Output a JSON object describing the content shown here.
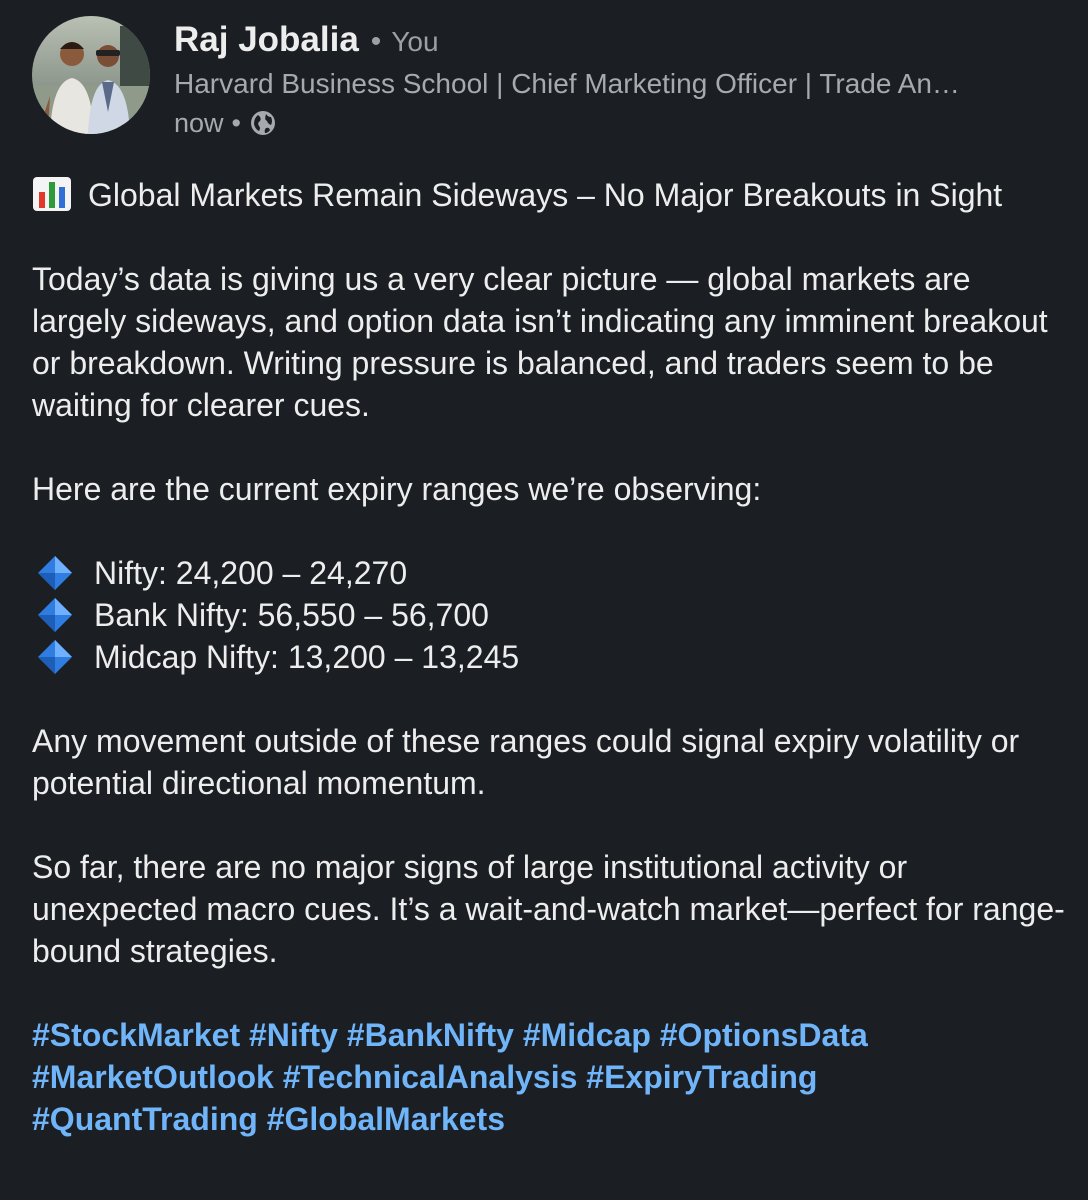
{
  "author": {
    "name": "Raj Jobalia",
    "relation": "You",
    "headline": "Harvard Business School | Chief Marketing Officer | Trade An…",
    "time": "now",
    "visibility_icon": "globe-icon"
  },
  "post": {
    "title_icon": "bar-chart-emoji",
    "title": "Global Markets Remain Sideways – No Major Breakouts in Sight",
    "intro": "Today’s data is giving us a very clear picture — global markets are largely sideways, and option data isn’t indicating any imminent breakout or breakdown. Writing pressure is balanced, and traders seem to be waiting for clearer cues.",
    "ranges_heading": "Here are the current expiry ranges we’re observing:",
    "ranges": [
      {
        "icon": "blue-diamond-emoji",
        "text": "Nifty: 24,200 – 24,270"
      },
      {
        "icon": "blue-diamond-emoji",
        "text": "Bank Nifty: 56,550 – 56,700"
      },
      {
        "icon": "blue-diamond-emoji",
        "text": "Midcap Nifty: 13,200 – 13,245"
      }
    ],
    "paragraph_movement": "Any movement outside of these ranges could signal expiry volatility or potential directional momentum.",
    "paragraph_outlook": "So far, there are no major signs of large institutional activity or unexpected macro cues. It’s a wait-and-watch market—perfect for range-bound strategies.",
    "hashtags": [
      "#StockMarket",
      "#Nifty",
      "#BankNifty",
      "#Midcap",
      "#OptionsData",
      "#MarketOutlook",
      "#TechnicalAnalysis",
      "#ExpiryTrading",
      "#QuantTrading",
      "#GlobalMarkets"
    ]
  },
  "colors": {
    "background": "#1b1f23",
    "text": "#ededed",
    "muted": "#a6aaaf",
    "hashtag": "#70b5f9"
  }
}
